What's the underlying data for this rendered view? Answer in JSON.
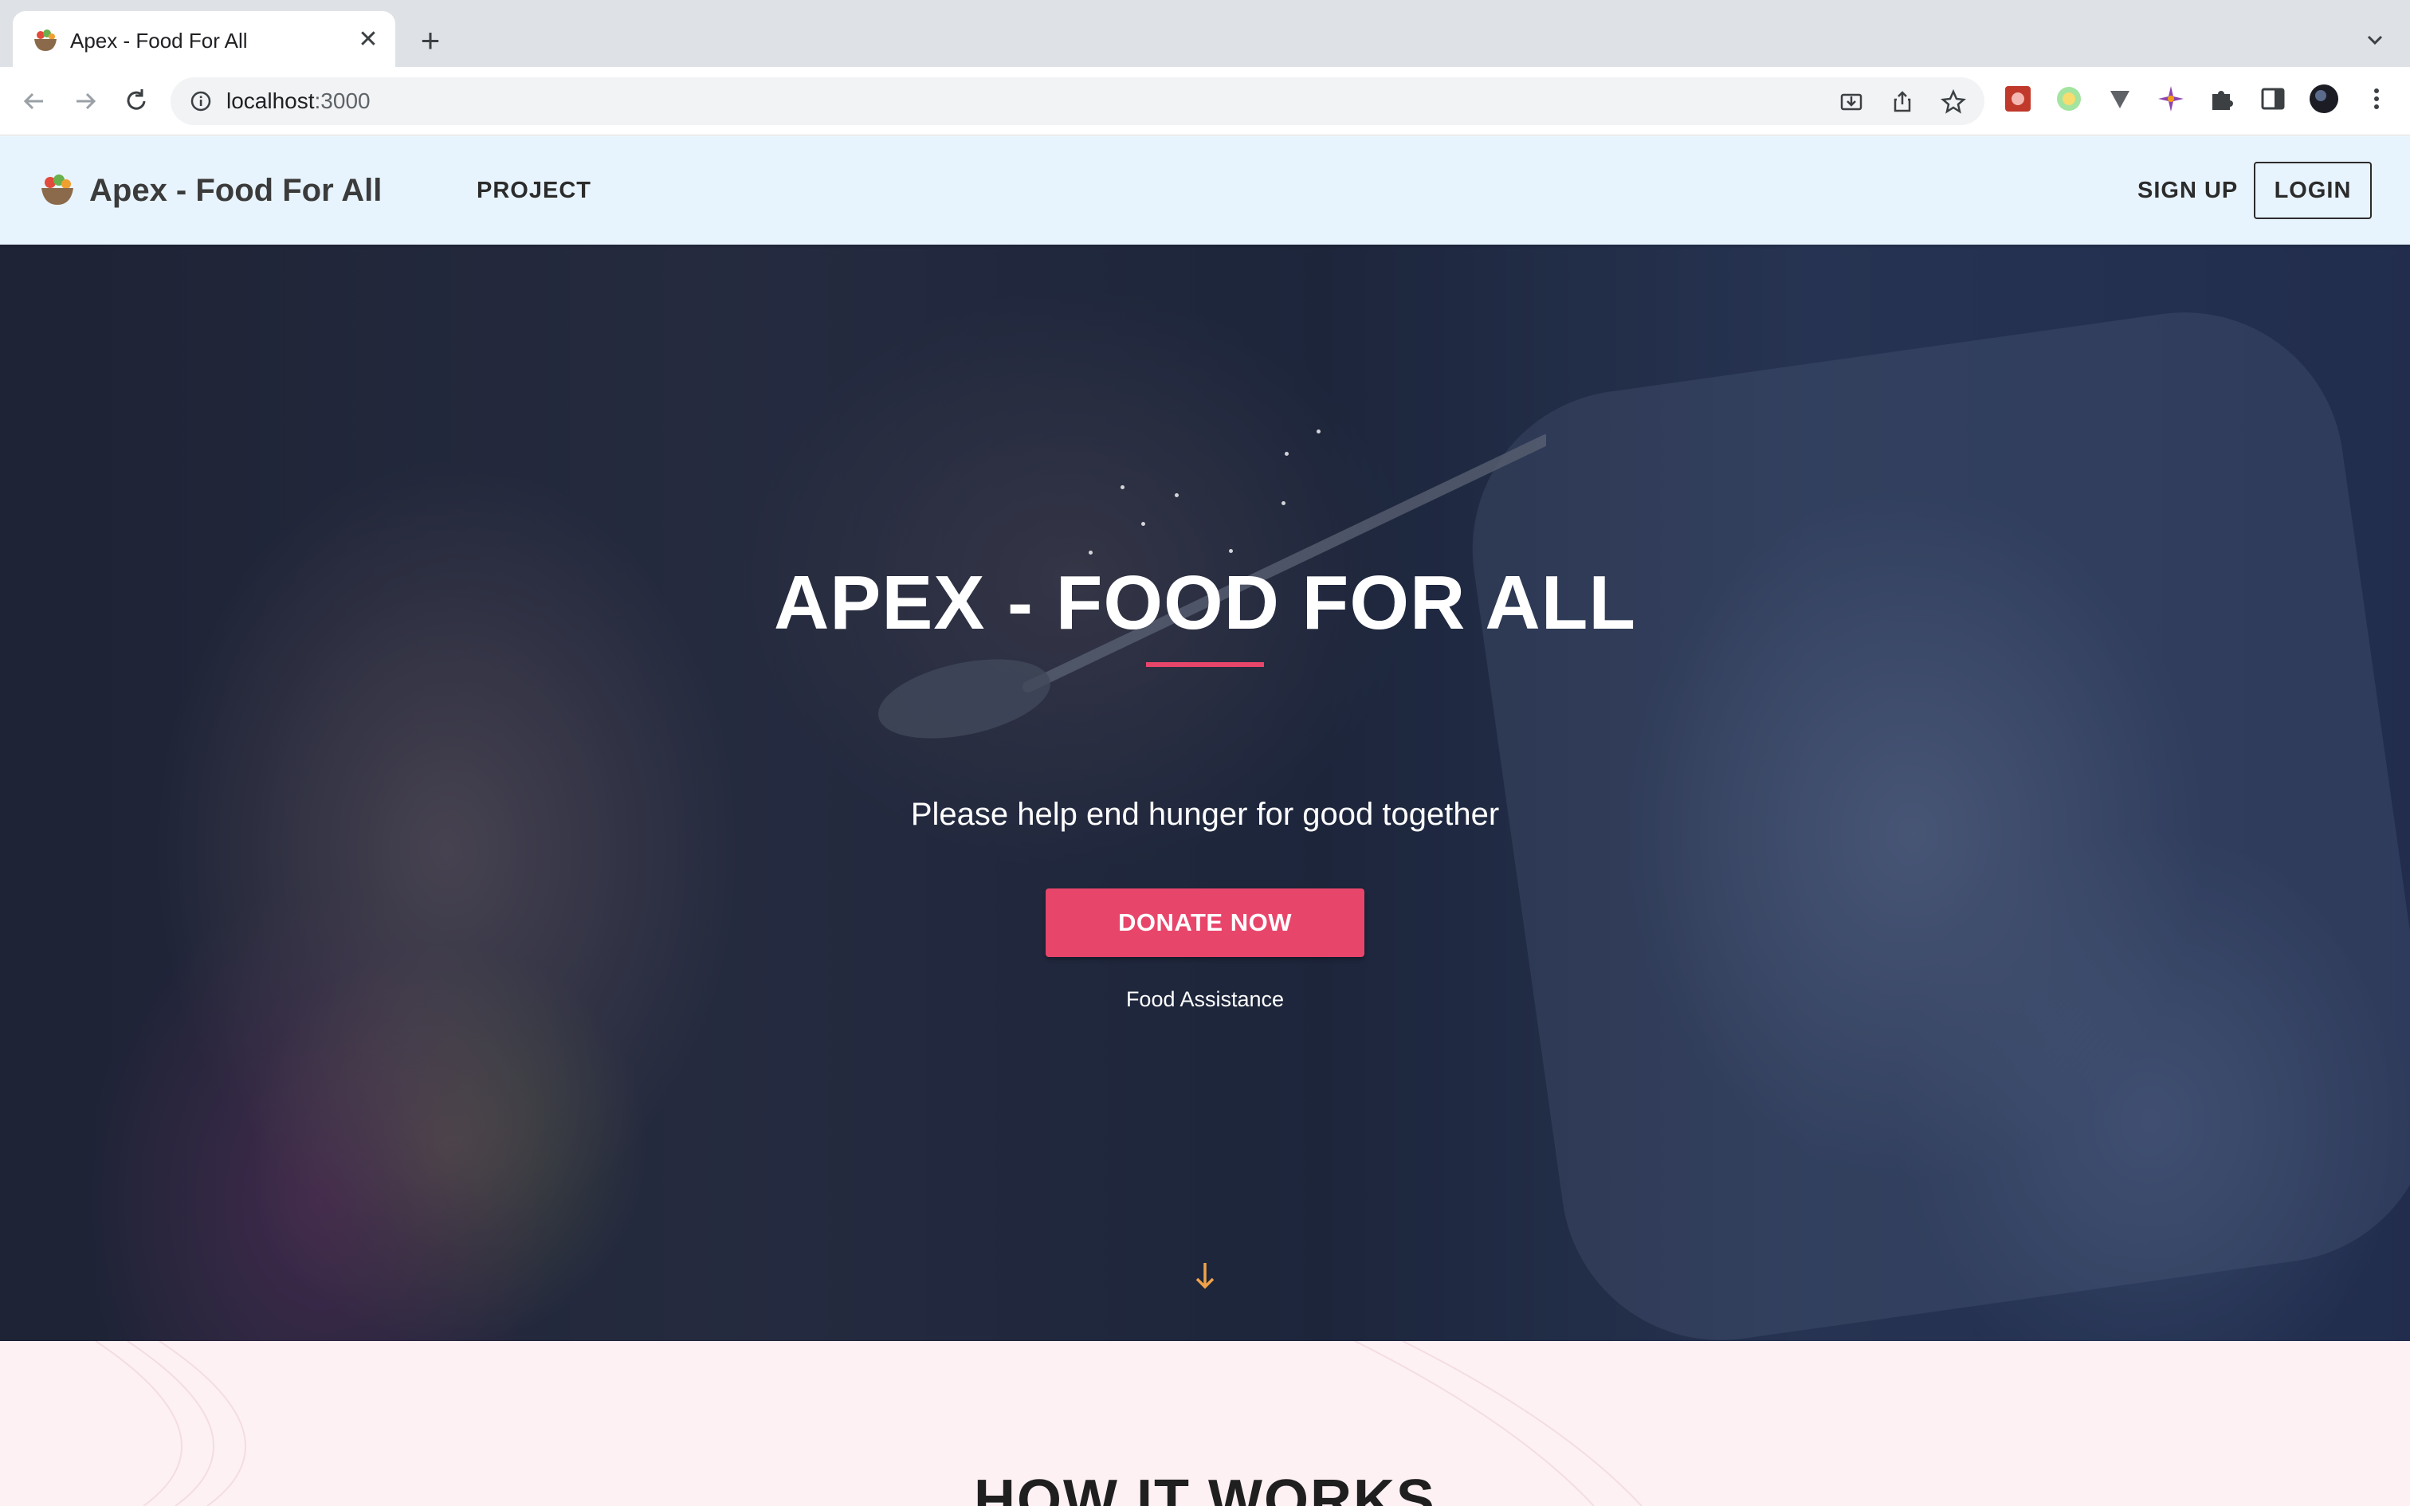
{
  "browser": {
    "tab_title": "Apex - Food For All",
    "url_host": "localhost",
    "url_port": ":3000",
    "new_tab_symbol": "+",
    "close_symbol": "✕"
  },
  "site": {
    "brand": "Apex - Food For All",
    "nav": {
      "project": "PROJECT",
      "sign_up": "SIGN UP",
      "login": "LOGIN"
    }
  },
  "hero": {
    "title": "APEX - FOOD FOR ALL",
    "subtitle": "Please help end hunger for good together",
    "donate_label": "DONATE NOW",
    "caption": "Food Assistance",
    "accent_color": "#e8456b"
  },
  "section": {
    "how_title": "HOW IT WORKS"
  },
  "icons": {
    "tab_favicon": "food-bowl-icon",
    "back": "back-arrow-icon",
    "forward": "forward-arrow-icon",
    "reload": "reload-icon",
    "site_info": "info-icon",
    "install": "install-icon",
    "share": "share-icon",
    "bookmark": "star-icon",
    "extensions": "puzzle-icon",
    "side_panel": "side-panel-icon",
    "profile": "avatar",
    "menu": "kebab-menu-icon",
    "scroll_down": "down-arrow-icon"
  }
}
